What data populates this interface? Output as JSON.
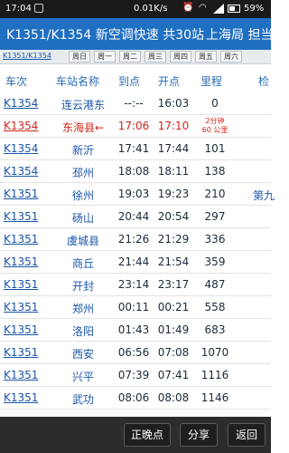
{
  "status": {
    "time": "17:04",
    "speed": "0.01K/s",
    "battery": "59%"
  },
  "title": {
    "text": "K1351/K1354 新空调快速 共30站",
    "bureau": "上海局 担当"
  },
  "weekday_bar": {
    "train": "K1351/K1354",
    "days": [
      "周日",
      "周一",
      "周二",
      "周三",
      "周四",
      "周五",
      "周六"
    ]
  },
  "table": {
    "headers": [
      "车次",
      "车站名称",
      "到点",
      "开点",
      "里程",
      "检"
    ],
    "rows": [
      {
        "train": "K1354",
        "station": "连云港东",
        "arr": "--:--",
        "dep": "16:03",
        "dist": "0",
        "extra": ""
      },
      {
        "train": "K1354",
        "station": "东海县",
        "arr": "17:06",
        "dep": "17:10",
        "dist": "2分钟\n60 公里",
        "extra": ""
      },
      {
        "train": "K1354",
        "station": "新沂",
        "arr": "17:41",
        "dep": "17:44",
        "dist": "101",
        "extra": ""
      },
      {
        "train": "K1354",
        "station": "邳州",
        "arr": "18:08",
        "dep": "18:11",
        "dist": "138",
        "extra": ""
      },
      {
        "train": "K1351",
        "station": "徐州",
        "arr": "19:03",
        "dep": "19:23",
        "dist": "210",
        "extra": "第九"
      },
      {
        "train": "K1351",
        "station": "砀山",
        "arr": "20:44",
        "dep": "20:54",
        "dist": "297",
        "extra": ""
      },
      {
        "train": "K1351",
        "station": "虞城县",
        "arr": "21:26",
        "dep": "21:29",
        "dist": "336",
        "extra": ""
      },
      {
        "train": "K1351",
        "station": "商丘",
        "arr": "21:44",
        "dep": "21:54",
        "dist": "359",
        "extra": ""
      },
      {
        "train": "K1351",
        "station": "开封",
        "arr": "23:14",
        "dep": "23:17",
        "dist": "487",
        "extra": ""
      },
      {
        "train": "K1351",
        "station": "郑州",
        "arr": "00:11",
        "dep": "00:21",
        "dist": "558",
        "extra": ""
      },
      {
        "train": "K1351",
        "station": "洛阳",
        "arr": "01:43",
        "dep": "01:49",
        "dist": "683",
        "extra": ""
      },
      {
        "train": "K1351",
        "station": "西安",
        "arr": "06:56",
        "dep": "07:08",
        "dist": "1070",
        "extra": ""
      },
      {
        "train": "K1351",
        "station": "兴平",
        "arr": "07:39",
        "dep": "07:41",
        "dist": "1116",
        "extra": ""
      },
      {
        "train": "K1351",
        "station": "武功",
        "arr": "08:06",
        "dep": "08:08",
        "dist": "1146",
        "extra": ""
      }
    ]
  },
  "buttons": {
    "late": "正晚点",
    "share": "分享",
    "back": "返回"
  },
  "colors": {
    "title_bar": "#1f6fc2",
    "highlight": "#d0261c",
    "link": "#1a56a8"
  }
}
